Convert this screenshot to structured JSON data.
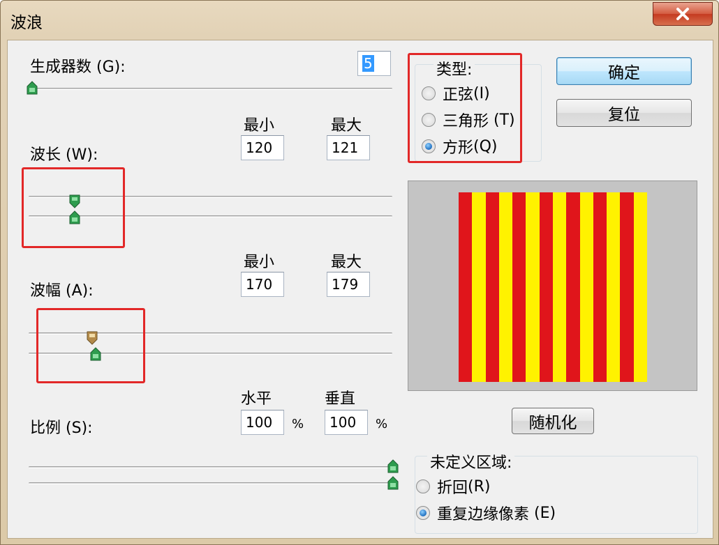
{
  "window": {
    "title": "波浪",
    "close_icon": "close-icon"
  },
  "generators": {
    "label": "生成器数",
    "hotkey": "(G)",
    "colon": ":",
    "value": "5",
    "slider_level": 0.0
  },
  "wavelength": {
    "label": "波长",
    "hotkey": "(W)",
    "colon": ":",
    "min_label": "最小",
    "max_label": "最大",
    "min_value": "120",
    "max_value": "121"
  },
  "amplitude": {
    "label": "波幅",
    "hotkey": "(A)",
    "colon": ":",
    "min_label": "最小",
    "max_label": "最大",
    "min_value": "170",
    "max_value": "179"
  },
  "scale": {
    "label": "比例",
    "hotkey": "(S)",
    "colon": ":",
    "horizontal_label": "水平",
    "vertical_label": "垂直",
    "horizontal_value": "100",
    "vertical_value": "100",
    "percent": "%"
  },
  "type_group": {
    "title": "类型:",
    "options": [
      {
        "label": "正弦",
        "hotkey": "(I)",
        "selected": false
      },
      {
        "label": "三角形",
        "hotkey": "(T)",
        "selected": false
      },
      {
        "label": "方形",
        "hotkey": "(Q)",
        "selected": true
      }
    ]
  },
  "buttons": {
    "ok": "确定",
    "reset": "复位",
    "randomize": "随机化"
  },
  "undefined_area": {
    "title": "未定义区域:",
    "options": [
      {
        "label": "折回",
        "hotkey": "(R)",
        "selected": false
      },
      {
        "label": "重复边缘像素",
        "hotkey": "(E)",
        "selected": true
      }
    ]
  },
  "preview": {
    "stripe_colors": [
      "#e0151b",
      "#fff200"
    ],
    "stripe_count": 14
  },
  "colors": {
    "highlight_box": "#e22828",
    "thumb_green": "#2e9c4e",
    "thumb_tan": "#b38a4a"
  }
}
